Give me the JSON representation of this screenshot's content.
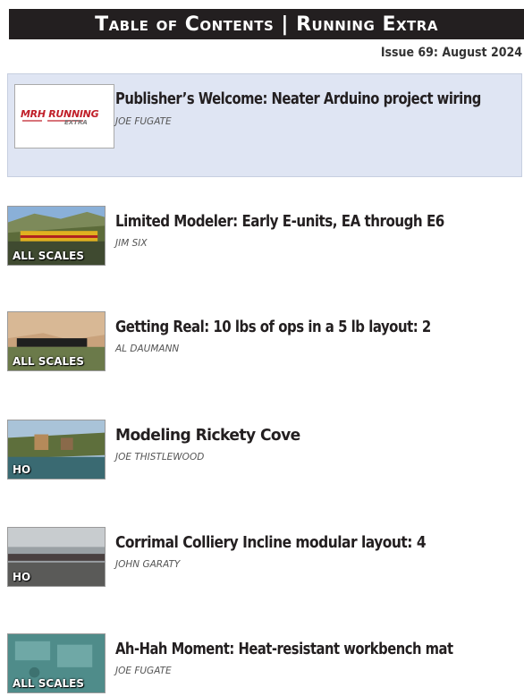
{
  "header": {
    "title": "Table of Contents | Running Extra",
    "issue": "Issue 69: August 2024"
  },
  "entries": [
    {
      "title": "Publisher’s Welcome: Neater Arduino project wiring",
      "author": "JOE FUGATE",
      "thumb": "mrh-running-extra-logo",
      "logo_main": "MRH RUNNING",
      "logo_sub": "EXTRA"
    },
    {
      "title": "Limited Modeler: Early E-units, EA through E6",
      "author": "JIM SIX",
      "badge": "ALL SCALES",
      "thumb": "yellow-train-photo"
    },
    {
      "title": "Getting Real: 10 lbs of ops in a 5 lb layout: 2",
      "author": "AL DAUMANN",
      "badge": "ALL SCALES",
      "thumb": "canyon-train-photo"
    },
    {
      "title": "Modeling Rickety Cove",
      "author": "JOE THISTLEWOOD",
      "badge": "HO",
      "thumb": "cove-village-photo"
    },
    {
      "title": "Corrimal Colliery Incline modular layout: 4",
      "author": "JOHN GARATY",
      "badge": "HO",
      "thumb": "colliery-layout-photo"
    },
    {
      "title": "Ah-Hah Moment: Heat-resistant workbench mat",
      "author": "JOE FUGATE",
      "badge": "ALL SCALES",
      "thumb": "workbench-mat-photo"
    }
  ],
  "colors": {
    "header_bg": "#231f20",
    "featured_bg": "#dfe5f3",
    "logo_red": "#c0202a"
  }
}
